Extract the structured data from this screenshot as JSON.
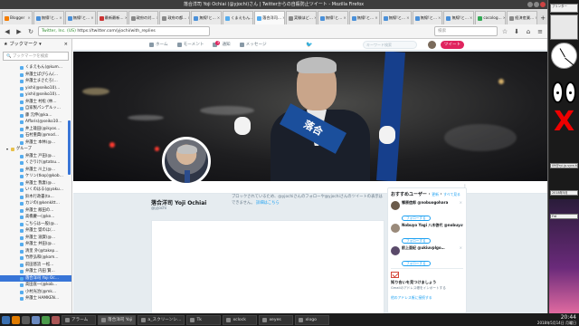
{
  "window": {
    "title": "落合洋司 Yoji Ochiai (@yjochi)さん | Twitterからの自殺防止ツイート - Mozilla Firefox"
  },
  "tabs": [
    {
      "label": "Blogger",
      "color": "#f57d00"
    },
    {
      "label": "無線!と…",
      "color": "#4a90d9"
    },
    {
      "label": "無線!と…",
      "color": "#4a90d9"
    },
    {
      "label": "最新最新…",
      "color": "#cc3333"
    },
    {
      "label": "政府の対…",
      "color": "#888888"
    },
    {
      "label": "政府の都…",
      "color": "#888888"
    },
    {
      "label": "無線!と…",
      "color": "#4a90d9"
    },
    {
      "label": "くまえもん…",
      "color": "#55acee"
    },
    {
      "label": "落合洋司…",
      "color": "#55acee"
    },
    {
      "label": "実験ほど…",
      "color": "#888888"
    },
    {
      "label": "無線!と…",
      "color": "#4a90d9"
    },
    {
      "label": "無線!と…",
      "color": "#4a90d9"
    },
    {
      "label": "無線!と…",
      "color": "#4a90d9"
    },
    {
      "label": "無線!と…",
      "color": "#4a90d9"
    },
    {
      "label": "無線!と…",
      "color": "#4a90d9"
    },
    {
      "label": "cocolog…",
      "color": "#33aa55"
    },
    {
      "label": "経済産業…",
      "color": "#888888"
    }
  ],
  "active_tab_index": 8,
  "nav": {
    "url_secure": "Twitter, Inc. (US)",
    "url": "https://twitter.com/yjochi/with_replies",
    "search_placeholder": "検索"
  },
  "sidebar": {
    "title": "ブックマーク",
    "search_placeholder": "ブックマークを検索",
    "items": [
      {
        "label": "くまえもん(@kum…",
        "type": "bookmark"
      },
      {
        "label": "弁護士ぱぴらん(…",
        "type": "bookmark"
      },
      {
        "label": "弁護士まさたろ(…",
        "type": "bookmark"
      },
      {
        "label": "yishi(@seiko10)…",
        "type": "bookmark"
      },
      {
        "label": "yishi(@seiko10)…",
        "type": "bookmark"
      },
      {
        "label": "弁護士 村松 (林…",
        "type": "bookmark"
      },
      {
        "label": "自家製パンデルッ…",
        "type": "bookmark"
      },
      {
        "label": "藤 元伸(@ka…",
        "type": "bookmark"
      },
      {
        "label": "Affaris(@seiko10…",
        "type": "bookmark"
      },
      {
        "label": "井上雄田(@ikyos…",
        "type": "bookmark"
      },
      {
        "label": "石村重典(@mod…",
        "type": "bookmark"
      },
      {
        "label": "弁護士 本林(@…",
        "type": "bookmark"
      },
      {
        "label": "グループ",
        "type": "folder"
      },
      {
        "label": "弁護士 戸田(@…",
        "type": "bookmark"
      },
      {
        "label": "くさりけ(@tatsu…",
        "type": "bookmark"
      },
      {
        "label": "弁護士 川上(@…",
        "type": "bookmark"
      },
      {
        "label": "ケリン(tkop)@kob…",
        "type": "bookmark"
      },
      {
        "label": "弁護士 我妻(@…",
        "type": "bookmark"
      },
      {
        "label": "いくのはる(@yaku…",
        "type": "bookmark"
      },
      {
        "label": "鈴木行政書(ta…",
        "type": "bookmark"
      },
      {
        "label": "カジの(@kenkitt…",
        "type": "bookmark"
      },
      {
        "label": "弁護士 飯田の…",
        "type": "bookmark"
      },
      {
        "label": "高橋慶一(@ke…",
        "type": "bookmark"
      },
      {
        "label": "こちらは一般(@…",
        "type": "bookmark"
      },
      {
        "label": "弁護士 盟のほ(…",
        "type": "bookmark"
      },
      {
        "label": "弁護士 滋賀(@…",
        "type": "bookmark"
      },
      {
        "label": "弁護士 井田(@…",
        "type": "bookmark"
      },
      {
        "label": "清里 外(@takep…",
        "type": "bookmark"
      },
      {
        "label": "竹原弘和(@kom…",
        "type": "bookmark"
      },
      {
        "label": "前田悠流 一松…",
        "type": "bookmark"
      },
      {
        "label": "弁護士 内田 賢…",
        "type": "bookmark"
      },
      {
        "label": "落合洋司 Yoji Oc…",
        "type": "bookmark",
        "selected": true
      },
      {
        "label": "高田直一(@kob…",
        "type": "bookmark"
      },
      {
        "label": "小村光治(@mk…",
        "type": "bookmark"
      },
      {
        "label": "弁護士 HAMKEN…",
        "type": "bookmark"
      }
    ]
  },
  "twitter": {
    "nav_home": "ホーム",
    "nav_moments": "モーメント",
    "nav_notifications": "通知",
    "nav_notifications_count": "3",
    "nav_messages": "メッセージ",
    "search_placeholder": "キーワード検索",
    "tweet_button": "ツイート",
    "banner_sash_text": "落合",
    "profile_name": "落合洋司 Yoji Ochiai",
    "profile_handle": "@yjochi",
    "blocked_message": "ブロックされているため、@yjochiさんのフォローや@yjochiさんのツイートの表示はできません。",
    "blocked_link": "詳細はこちら",
    "who_to_follow": {
      "title": "おすすめユーザー",
      "refresh": "更新",
      "view_all": "すべて見る",
      "users": [
        {
          "name": "郷原信郎 @nobuogohara",
          "follow": "フォローする"
        },
        {
          "name": "Nobuyo Yagi 八木啓代 @nobuyoyagi",
          "follow": "フォローする"
        },
        {
          "name": "前上亜紀 @ukiuvplgo…",
          "follow": "フォローする"
        }
      ],
      "gmail_title": "知り合いを見つけましょう",
      "gmail_sub": "Gmailのアドレス帳をインポートする",
      "more": "他のアドレス帳に接続する"
    }
  },
  "desktop": {
    "widget1": "プリンター",
    "widget2": "09@ryi.jp.syra.it",
    "widget3": "2018年5月",
    "widget4": "Frd"
  },
  "taskbar": {
    "tasks": [
      {
        "label": "アラーム",
        "active": false
      },
      {
        "label": "落合洋司 Yoji",
        "active": true
      },
      {
        "label": "a_スクリーンシ…",
        "active": false
      },
      {
        "label": "Tk",
        "active": false
      },
      {
        "label": "xclock",
        "active": false
      },
      {
        "label": "xeyes",
        "active": false
      },
      {
        "label": "xlogo",
        "active": false
      }
    ],
    "time": "20:44",
    "date": "2018年5月14日 月曜日"
  },
  "colors": {
    "twitter_blue": "#1da1f2",
    "tweet_button": "#e0245e",
    "sidebar_selection": "#3875d7"
  }
}
